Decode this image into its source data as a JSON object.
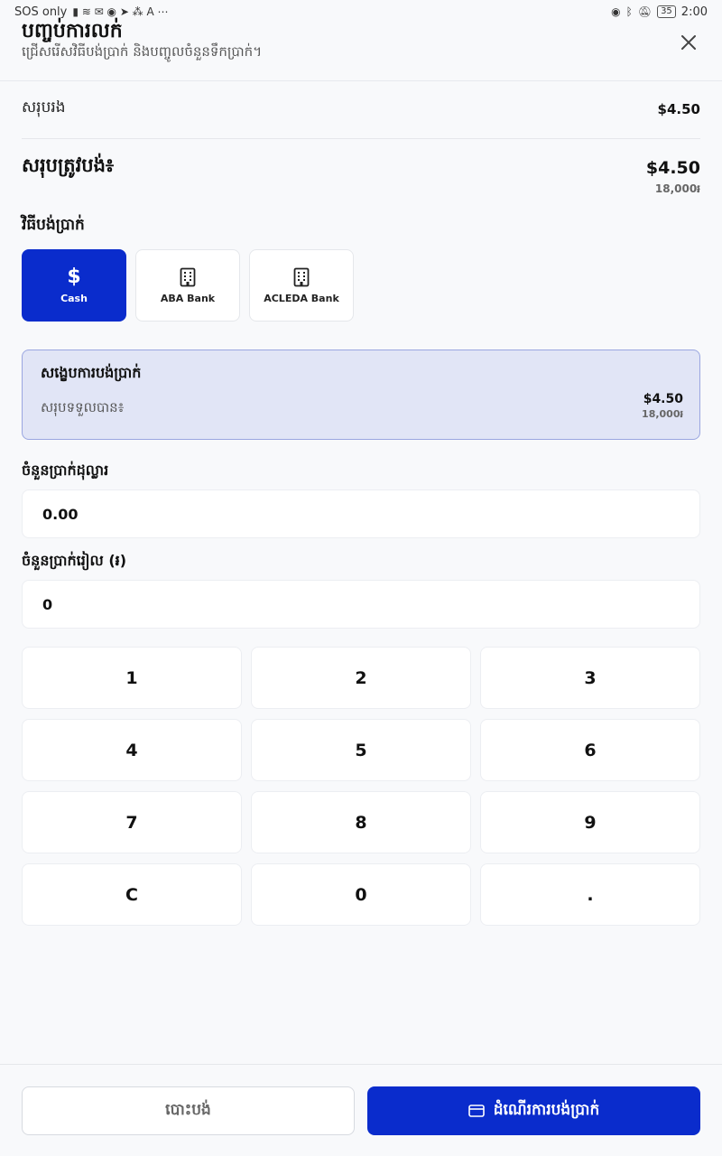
{
  "status_bar": {
    "carrier": "SOS only",
    "time": "2:00",
    "battery": "35"
  },
  "header": {
    "title": "បញ្ចប់ការលក់",
    "subtitle": "ជ្រើសរើសវិធីបង់ប្រាក់ និងបញ្ចូលចំនួនទឹកប្រាក់។"
  },
  "summary": {
    "subtotal_label": "សរុបរង",
    "subtotal_value": "$4.50",
    "total_label": "សរុបត្រូវបង់៖",
    "total_value": "$4.50",
    "total_riel": "18,000៛"
  },
  "payment_methods": {
    "label": "វិធីបង់ប្រាក់",
    "items": [
      {
        "label": "Cash",
        "icon": "dollar-icon",
        "active": true
      },
      {
        "label": "ABA Bank",
        "icon": "bank-building-icon",
        "active": false
      },
      {
        "label": "ACLEDA Bank",
        "icon": "bank-building-icon",
        "active": false
      }
    ]
  },
  "payment_summary": {
    "title": "សង្ខេបការបង់ប្រាក់",
    "received_label": "សរុបទទួលបាន៖",
    "received_usd": "$4.50",
    "received_riel": "18,000៛"
  },
  "inputs": {
    "usd_label": "ចំនួនប្រាក់ដុល្លារ",
    "usd_value": "0.00",
    "riel_label": "ចំនួនប្រាក់រៀល (៛)",
    "riel_value": "0"
  },
  "keypad": [
    "1",
    "2",
    "3",
    "4",
    "5",
    "6",
    "7",
    "8",
    "9",
    "C",
    "0",
    "."
  ],
  "footer": {
    "cancel_label": "បោះបង់",
    "pay_label": "ដំណើរការបង់ប្រាក់"
  },
  "colors": {
    "accent": "#0a2ccc",
    "summary_bg": "#e1e5f6",
    "summary_border": "#9aa6e0",
    "background": "#f8f9fb"
  }
}
